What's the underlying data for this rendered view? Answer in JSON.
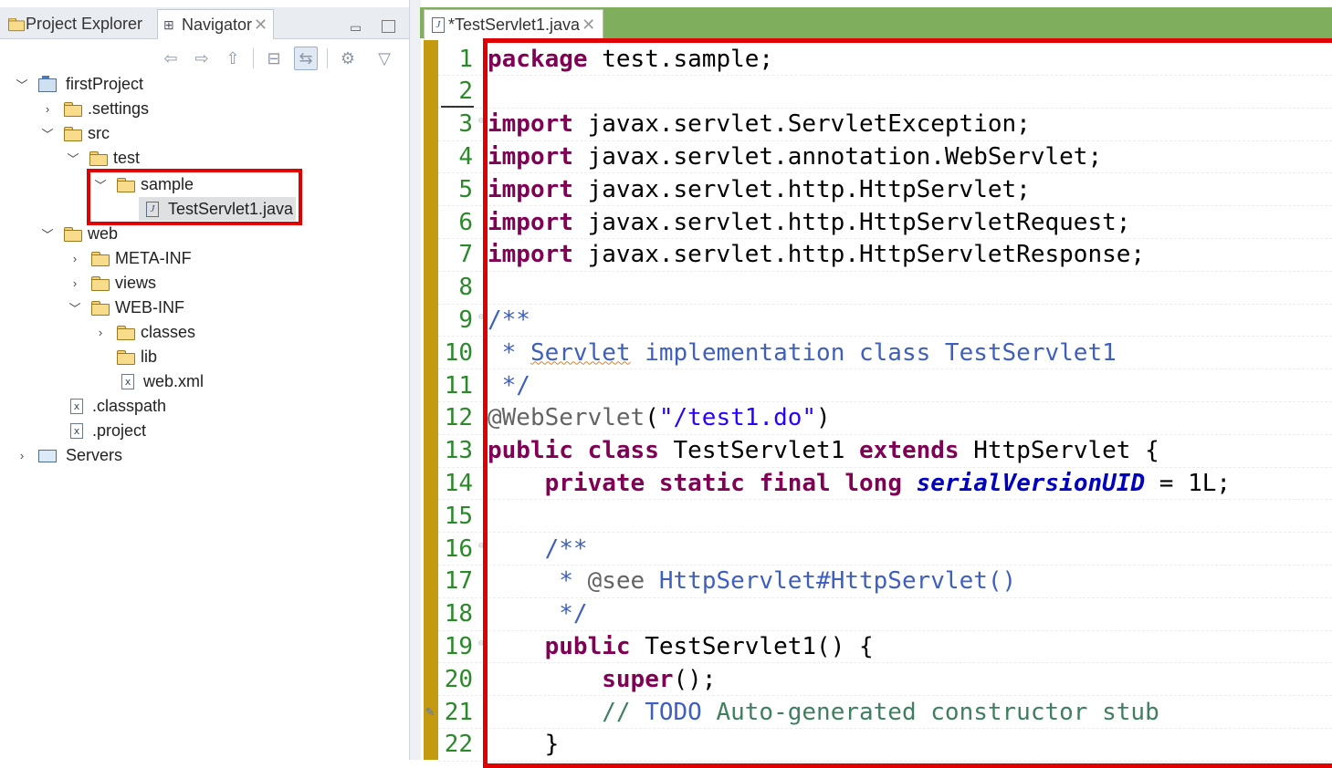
{
  "left_panel": {
    "tabs": [
      {
        "label": "Project Explorer"
      },
      {
        "label": "Navigator"
      }
    ],
    "tree": [
      {
        "label": "firstProject"
      },
      {
        "label": ".settings"
      },
      {
        "label": "src"
      },
      {
        "label": "test"
      },
      {
        "label": "sample"
      },
      {
        "label": "TestServlet1.java"
      },
      {
        "label": "web"
      },
      {
        "label": "META-INF"
      },
      {
        "label": "views"
      },
      {
        "label": "WEB-INF"
      },
      {
        "label": "classes"
      },
      {
        "label": "lib"
      },
      {
        "label": "web.xml"
      },
      {
        "label": ".classpath"
      },
      {
        "label": ".project"
      },
      {
        "label": "Servers"
      }
    ]
  },
  "editor": {
    "tab_label": "*TestServlet1.java",
    "lines": [
      {
        "num": "1",
        "t": [
          "package",
          " test.sample;"
        ]
      },
      {
        "num": "2",
        "t": []
      },
      {
        "num": "3",
        "t": [
          "import",
          " javax.servlet.ServletException;"
        ]
      },
      {
        "num": "4",
        "t": [
          "import",
          " javax.servlet.annotation.WebServlet;"
        ]
      },
      {
        "num": "5",
        "t": [
          "import",
          " javax.servlet.http.HttpServlet;"
        ]
      },
      {
        "num": "6",
        "t": [
          "import",
          " javax.servlet.http.HttpServletRequest;"
        ]
      },
      {
        "num": "7",
        "t": [
          "import",
          " javax.servlet.http.HttpServletResponse;"
        ]
      },
      {
        "num": "8",
        "t": []
      },
      {
        "num": "9",
        "t": [
          "/**"
        ]
      },
      {
        "num": "10",
        "t": [
          " * ",
          "Servlet",
          " implementation class TestServlet1"
        ]
      },
      {
        "num": "11",
        "t": [
          " */"
        ]
      },
      {
        "num": "12",
        "t": [
          "@WebServlet",
          "(",
          "\"/test1.do\"",
          ")"
        ]
      },
      {
        "num": "13",
        "t": [
          "public",
          " ",
          "class",
          " TestServlet1 ",
          "extends",
          " HttpServlet {"
        ]
      },
      {
        "num": "14",
        "t": [
          "    ",
          "private",
          " ",
          "static",
          " ",
          "final",
          " ",
          "long",
          " ",
          "serialVersionUID",
          " = 1L;"
        ]
      },
      {
        "num": "15",
        "t": []
      },
      {
        "num": "16",
        "t": [
          "    /**"
        ]
      },
      {
        "num": "17",
        "t": [
          "     * ",
          "@see",
          " HttpServlet#HttpServlet()"
        ]
      },
      {
        "num": "18",
        "t": [
          "     */"
        ]
      },
      {
        "num": "19",
        "t": [
          "    ",
          "public",
          " TestServlet1() {"
        ]
      },
      {
        "num": "20",
        "t": [
          "        ",
          "super",
          "();"
        ]
      },
      {
        "num": "21",
        "t": [
          "        // ",
          "TODO",
          " Auto-generated constructor stub"
        ]
      },
      {
        "num": "22",
        "t": [
          "    }"
        ]
      }
    ]
  }
}
